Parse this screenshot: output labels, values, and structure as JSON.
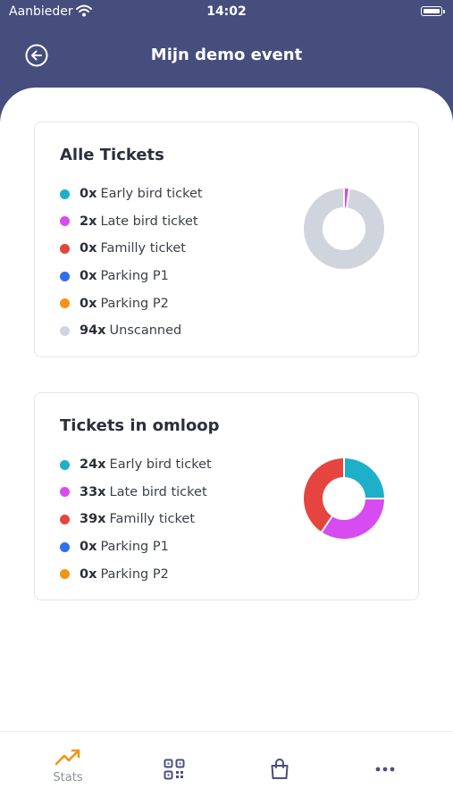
{
  "status_bar": {
    "carrier": "Aanbieder",
    "time": "14:02"
  },
  "nav": {
    "title": "Mijn demo event"
  },
  "colors": {
    "header": "#454e7d",
    "early_bird": "#1eafc9",
    "late_bird": "#d64cf0",
    "familly": "#e6443f",
    "parking_p1": "#2f6ff0",
    "parking_p2": "#f29416",
    "unscanned": "#d0d4dd",
    "tab_active": "#f29416"
  },
  "cards": [
    {
      "title": "Alle Tickets",
      "items": [
        {
          "count": "0x",
          "label": "Early bird ticket",
          "value": 0,
          "color": "#1eafc9"
        },
        {
          "count": "2x",
          "label": "Late bird ticket",
          "value": 2,
          "color": "#d64cf0"
        },
        {
          "count": "0x",
          "label": "Familly ticket",
          "value": 0,
          "color": "#e6443f"
        },
        {
          "count": "0x",
          "label": "Parking P1",
          "value": 0,
          "color": "#2f6ff0"
        },
        {
          "count": "0x",
          "label": "Parking P2",
          "value": 0,
          "color": "#f29416"
        },
        {
          "count": "94x",
          "label": "Unscanned",
          "value": 94,
          "color": "#d0d4dd"
        }
      ]
    },
    {
      "title": "Tickets in omloop",
      "items": [
        {
          "count": "24x",
          "label": "Early bird ticket",
          "value": 24,
          "color": "#1eafc9"
        },
        {
          "count": "33x",
          "label": "Late bird ticket",
          "value": 33,
          "color": "#d64cf0"
        },
        {
          "count": "39x",
          "label": "Familly ticket",
          "value": 39,
          "color": "#e6443f"
        },
        {
          "count": "0x",
          "label": "Parking P1",
          "value": 0,
          "color": "#2f6ff0"
        },
        {
          "count": "0x",
          "label": "Parking P2",
          "value": 0,
          "color": "#f29416"
        }
      ]
    }
  ],
  "tabbar": {
    "tabs": [
      {
        "label": "Stats",
        "icon": "trending-up-icon",
        "active": true
      },
      {
        "label": "",
        "icon": "qr-code-icon",
        "active": false
      },
      {
        "label": "",
        "icon": "shopping-bag-icon",
        "active": false
      },
      {
        "label": "",
        "icon": "more-icon",
        "active": false
      }
    ]
  }
}
